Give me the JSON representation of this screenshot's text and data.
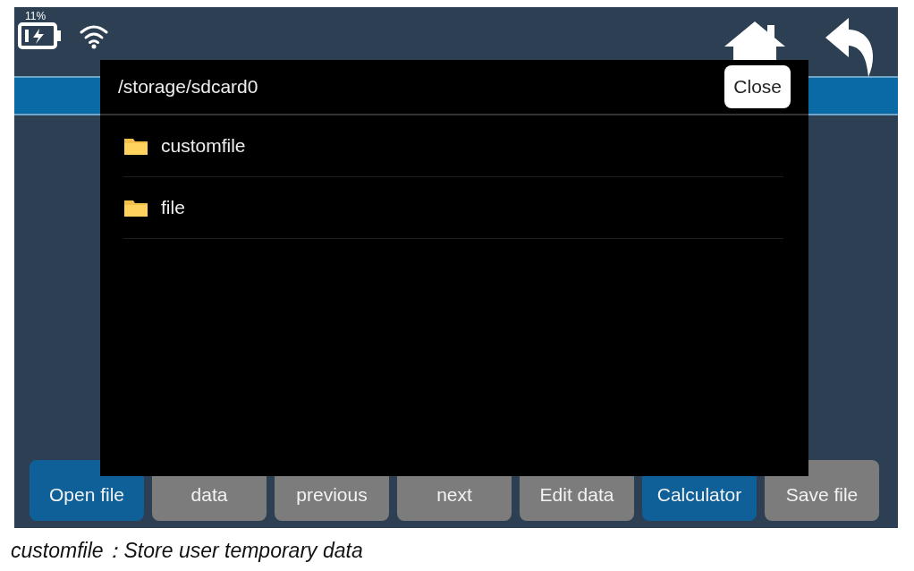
{
  "status_bar": {
    "battery": "11%"
  },
  "dialog": {
    "path": "/storage/sdcard0",
    "close_button": "Close",
    "entries": [
      {
        "name": "customfile"
      },
      {
        "name": "file"
      }
    ]
  },
  "toolbar": [
    {
      "label": "Open file",
      "highlighted": true
    },
    {
      "label": "data",
      "highlighted": false
    },
    {
      "label": "previous",
      "highlighted": false
    },
    {
      "label": "next",
      "highlighted": false
    },
    {
      "label": "Edit data",
      "highlighted": false
    },
    {
      "label": "Calculator",
      "highlighted": true
    },
    {
      "label": "Save file",
      "highlighted": false
    }
  ],
  "caption": "customfile：Store user temporary data"
}
